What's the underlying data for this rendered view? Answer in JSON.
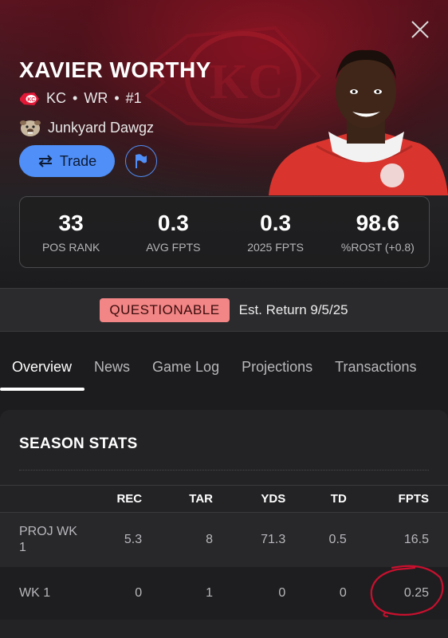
{
  "player": {
    "name": "XAVIER WORTHY",
    "team": "KC",
    "position": "WR",
    "rank": "#1",
    "fantasy_team": "Junkyard Dawgz"
  },
  "actions": {
    "trade_label": "Trade"
  },
  "stats": [
    {
      "value": "33",
      "label": "POS RANK"
    },
    {
      "value": "0.3",
      "label": "AVG FPTS"
    },
    {
      "value": "0.3",
      "label": "2025 FPTS"
    },
    {
      "value": "98.6",
      "label": "%ROST (+0.8)"
    }
  ],
  "status": {
    "badge": "QUESTIONABLE",
    "return": "Est. Return 9/5/25",
    "badge_color": "#f28585"
  },
  "tabs": [
    "Overview",
    "News",
    "Game Log",
    "Projections",
    "Transactions"
  ],
  "active_tab": "Overview",
  "season_stats": {
    "title": "SEASON STATS",
    "columns": [
      "",
      "REC",
      "TAR",
      "YDS",
      "TD",
      "FPTS"
    ],
    "rows": [
      {
        "label": "PROJ WK 1",
        "rec": "5.3",
        "tar": "8",
        "yds": "71.3",
        "td": "0.5",
        "fpts": "16.5"
      },
      {
        "label": "WK 1",
        "rec": "0",
        "tar": "1",
        "yds": "0",
        "td": "0",
        "fpts": "0.25"
      }
    ]
  },
  "colors": {
    "accent": "#4f8ff7",
    "team_red": "#e31837",
    "annotation": "#c8102e"
  }
}
